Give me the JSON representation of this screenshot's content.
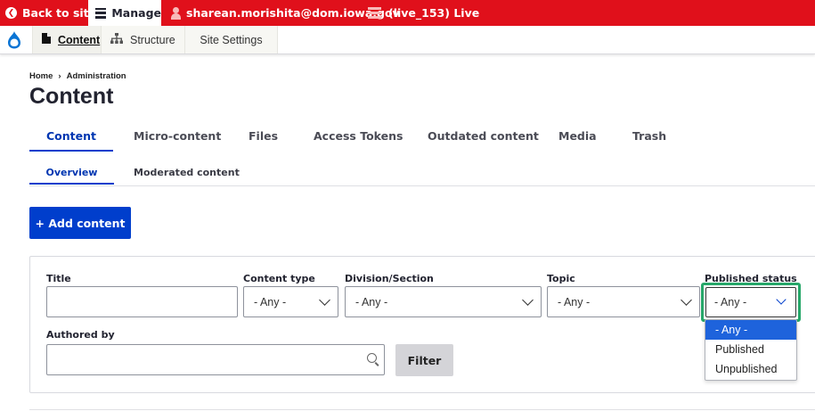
{
  "toolbar": {
    "back_label": "Back to site",
    "manage_label": "Manage",
    "user_label": "sharean.morishita@dom.iowa.gov",
    "env_label": "(live_153) Live"
  },
  "tray": {
    "content_label": "Content",
    "structure_label": "Structure",
    "settings_label": "Site Settings"
  },
  "breadcrumb": {
    "home": "Home",
    "separator": "›",
    "admin": "Administration"
  },
  "page_title": "Content",
  "primary_tabs": [
    {
      "label": "Content",
      "active": true
    },
    {
      "label": "Micro-content"
    },
    {
      "label": "Files"
    },
    {
      "label": "Access Tokens"
    },
    {
      "label": "Outdated content"
    },
    {
      "label": "Media"
    },
    {
      "label": "Trash"
    }
  ],
  "secondary_tabs": [
    {
      "label": "Overview",
      "active": true
    },
    {
      "label": "Moderated content"
    }
  ],
  "add_button": "+ Add content",
  "filters": {
    "title_label": "Title",
    "title_value": "",
    "content_type_label": "Content type",
    "content_type_value": "- Any -",
    "division_label": "Division/Section",
    "division_value": "- Any -",
    "topic_label": "Topic",
    "topic_value": "- Any -",
    "published_label": "Published status",
    "published_value": "- Any -",
    "authored_label": "Authored by",
    "authored_value": "",
    "filter_button": "Filter"
  },
  "published_options": [
    {
      "label": "- Any -",
      "selected": true
    },
    {
      "label": "Published"
    },
    {
      "label": "Unpublished"
    }
  ],
  "colors": {
    "toolbar_red": "#e0101b",
    "accent_blue": "#003ecc",
    "focus_green": "#26a769"
  }
}
